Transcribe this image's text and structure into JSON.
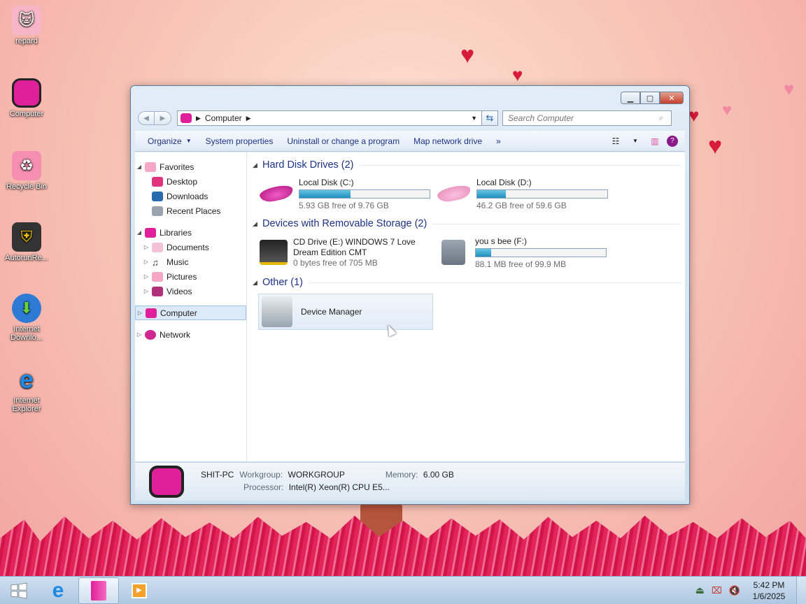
{
  "desktop": {
    "icons": [
      {
        "label": "repard",
        "icon": "cat-doll-icon"
      },
      {
        "label": "Computer",
        "icon": "computer-icon"
      },
      {
        "label": "Recycle Bin",
        "icon": "recycle-bin-icon"
      },
      {
        "label": "AutorunRe...",
        "icon": "usb-shield-icon"
      },
      {
        "label": "Internet Downlo...",
        "icon": "download-manager-icon"
      },
      {
        "label": "Internet Explorer",
        "icon": "ie-icon"
      }
    ]
  },
  "window": {
    "address": {
      "location": "Computer"
    },
    "search": {
      "placeholder": "Search Computer"
    },
    "toolbar": {
      "organize": "Organize",
      "system_properties": "System properties",
      "uninstall": "Uninstall or change a program",
      "map_drive": "Map network drive",
      "more": "»"
    },
    "nav": {
      "favorites": "Favorites",
      "desktop": "Desktop",
      "downloads": "Downloads",
      "recent": "Recent Places",
      "libraries": "Libraries",
      "documents": "Documents",
      "music": "Music",
      "pictures": "Pictures",
      "videos": "Videos",
      "computer": "Computer",
      "network": "Network"
    },
    "groups": {
      "hdd": {
        "title": "Hard Disk Drives (2)",
        "items": [
          {
            "name": "Local Disk (C:)",
            "free": "5.93 GB free of 9.76 GB",
            "used_fraction": 0.39
          },
          {
            "name": "Local Disk (D:)",
            "free": "46.2 GB free of 59.6 GB",
            "used_fraction": 0.22
          }
        ]
      },
      "removable": {
        "title": "Devices with Removable Storage (2)",
        "items": [
          {
            "name": "CD Drive (E:) WINDOWS 7 Love Dream Edition CMT",
            "free": "0 bytes free of 705 MB"
          },
          {
            "name": "you s bee (F:)",
            "free": "88.1 MB free of 99.9 MB",
            "used_fraction": 0.12
          }
        ]
      },
      "other": {
        "title": "Other (1)",
        "items": [
          {
            "name": "Device Manager"
          }
        ]
      }
    },
    "details": {
      "pc_name": "SHIT-PC",
      "workgroup_label": "Workgroup:",
      "workgroup": "WORKGROUP",
      "memory_label": "Memory:",
      "memory": "6.00 GB",
      "processor_label": "Processor:",
      "processor": "Intel(R) Xeon(R) CPU E5..."
    }
  },
  "taskbar": {
    "time": "5:42 PM",
    "date": "1/6/2025"
  },
  "colors": {
    "accent": "#1e3287",
    "brand_pink": "#e01f9a",
    "bar_fill": "#1f8fbd"
  }
}
